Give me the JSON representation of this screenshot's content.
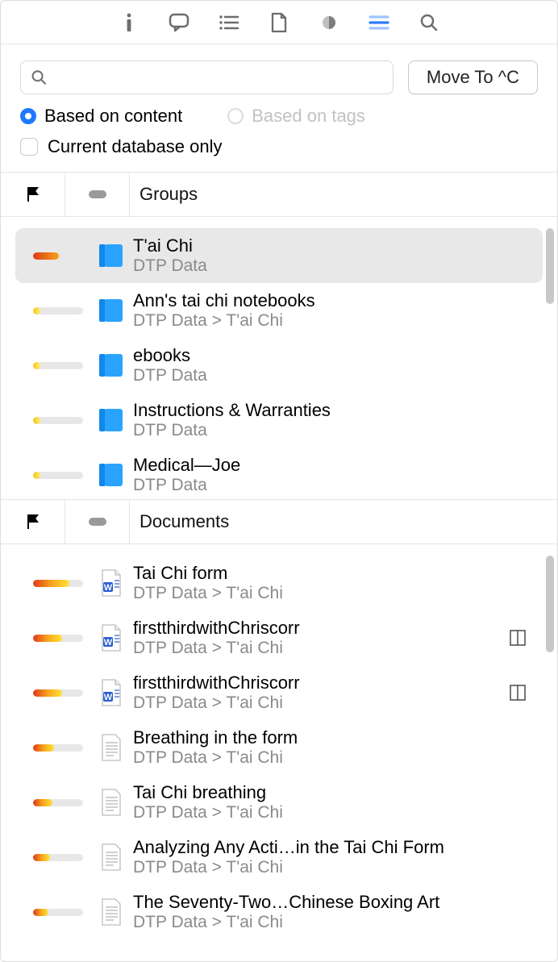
{
  "toolbar": {
    "icons": [
      "info-icon",
      "comment-icon",
      "list-icon",
      "document-icon",
      "dot-icon",
      "lines-icon",
      "search-icon"
    ],
    "active_index": 5
  },
  "search": {
    "placeholder": ""
  },
  "move_button_label": "Move To ^C",
  "filters": {
    "radio_content_label": "Based on content",
    "radio_tags_label": "Based on tags",
    "radio_selected": "content",
    "current_db_label": "Current database only",
    "current_db_checked": false
  },
  "sections": {
    "groups_title": "Groups",
    "documents_title": "Documents"
  },
  "groups": [
    {
      "title": "T'ai Chi",
      "path": "DTP Data",
      "bar_pct": 52,
      "bar_class": "grad-ry",
      "selected": true
    },
    {
      "title": "Ann's tai chi notebooks",
      "path": "DTP Data > T'ai Chi",
      "bar_pct": 14,
      "bar_class": "grad-y"
    },
    {
      "title": "ebooks",
      "path": "DTP Data",
      "bar_pct": 14,
      "bar_class": "grad-y"
    },
    {
      "title": "Instructions & Warranties",
      "path": "DTP Data",
      "bar_pct": 14,
      "bar_class": "grad-y"
    },
    {
      "title": "Medical—Joe",
      "path": "DTP Data",
      "bar_pct": 14,
      "bar_class": "grad-y"
    }
  ],
  "documents": [
    {
      "title": "Tai Chi form",
      "path": "DTP Data > T'ai Chi",
      "bar_pct": 72,
      "bar_class": "grad-ryg",
      "icon": "word",
      "dup": false
    },
    {
      "title": "firstthirdwithChriscorr",
      "path": "DTP Data > T'ai Chi",
      "bar_pct": 58,
      "bar_class": "grad-ryg",
      "icon": "word",
      "dup": true
    },
    {
      "title": "firstthirdwithChriscorr",
      "path": "DTP Data > T'ai Chi",
      "bar_pct": 58,
      "bar_class": "grad-ryg",
      "icon": "word",
      "dup": true
    },
    {
      "title": "Breathing in the form",
      "path": "DTP Data > T'ai Chi",
      "bar_pct": 42,
      "bar_class": "grad-ryg",
      "icon": "txt",
      "dup": false
    },
    {
      "title": "Tai Chi breathing",
      "path": "DTP Data > T'ai Chi",
      "bar_pct": 38,
      "bar_class": "grad-ryg",
      "icon": "txt",
      "dup": false
    },
    {
      "title": "Analyzing Any Acti…in the Tai Chi Form",
      "path": "DTP Data > T'ai Chi",
      "bar_pct": 34,
      "bar_class": "grad-ryg",
      "icon": "txt",
      "dup": false
    },
    {
      "title": "The Seventy-Two…Chinese Boxing Art",
      "path": "DTP Data > T'ai Chi",
      "bar_pct": 30,
      "bar_class": "grad-ryg",
      "icon": "txt",
      "dup": false
    }
  ]
}
